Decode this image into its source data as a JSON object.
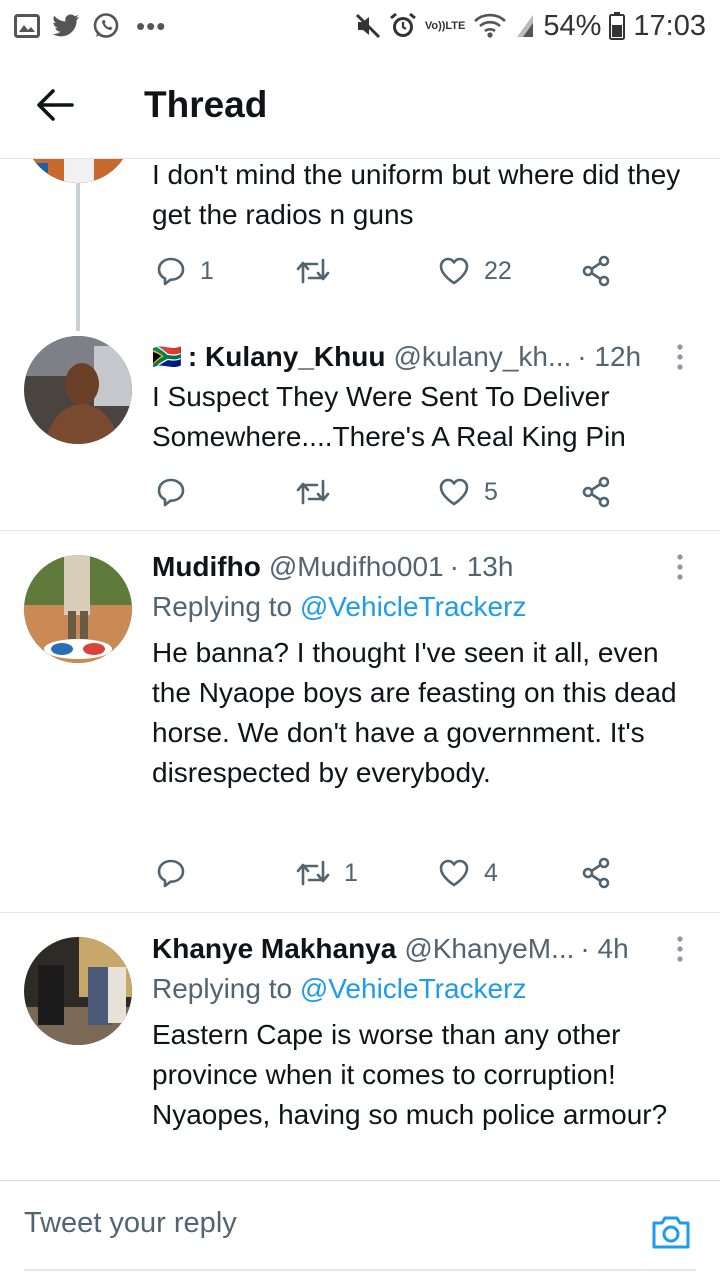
{
  "status_bar": {
    "battery": "54%",
    "time": "17:03",
    "volte_top": "Vo))",
    "volte_bottom": "LTE",
    "left_icons": [
      "gallery-icon",
      "twitter-icon",
      "whatsapp-icon"
    ],
    "more": "•••"
  },
  "header": {
    "title": "Thread"
  },
  "tweets": [
    {
      "text": "I don't mind the uniform but where did they get the radios n guns",
      "actions": {
        "reply": "1",
        "retweet": "",
        "like": "22"
      }
    },
    {
      "flag": "🇿🇦",
      "name": ": Kulany_Khuu",
      "handle": "@kulany_kh...",
      "time": "· 12h",
      "text": "I Suspect They Were Sent To Deliver Somewhere....There's A Real King Pin",
      "actions": {
        "reply": "",
        "retweet": "",
        "like": "5"
      }
    },
    {
      "name": "Mudifho",
      "handle": "@Mudifho001",
      "time": "· 13h",
      "replying_prefix": "Replying to ",
      "replying_to": "@VehicleTrackerz",
      "text": "He banna? I thought I've seen it all, even the Nyaope boys are feasting on this dead horse. We don't have a government.  It's disrespected by everybody.",
      "actions": {
        "reply": "",
        "retweet": "1",
        "like": "4"
      }
    },
    {
      "name": "Khanye Makhanya",
      "handle": "@KhanyeM...",
      "time": "· 4h",
      "replying_prefix": "Replying to ",
      "replying_to": "@VehicleTrackerz",
      "text": "Eastern Cape is worse than any other province when it comes to corruption! Nyaopes, having so much police armour?"
    }
  ],
  "reply_bar": {
    "placeholder": "Tweet your reply"
  },
  "colors": {
    "accent": "#1d9bf0",
    "text": "#0f1419",
    "secondary": "#536471",
    "divider": "#e1e5e8"
  }
}
